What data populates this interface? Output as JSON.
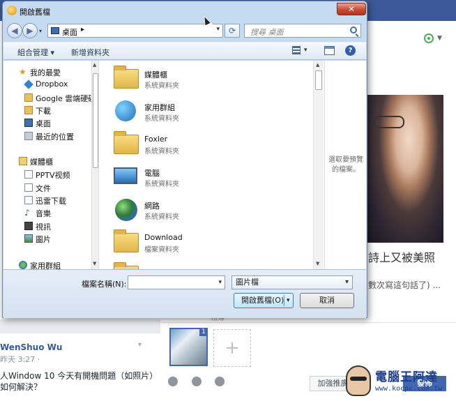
{
  "dialog": {
    "title": "開啟舊檔",
    "close_glyph": "✕",
    "address": {
      "location": "桌面",
      "chevron": "▸",
      "dropdown": "▾"
    },
    "search": {
      "placeholder": "搜尋 桌面"
    },
    "toolbar": {
      "organize": "組合管理 ▾",
      "new_folder": "新增資料夾",
      "help": "?"
    },
    "nav_pane": {
      "items": [
        {
          "label": "我的最愛",
          "icon": "star-icon"
        },
        {
          "label": "Dropbox",
          "icon": "dropbox-icon"
        },
        {
          "label": "Google 雲端硬碟",
          "icon": "drive-icon"
        },
        {
          "label": "下載",
          "icon": "downloads-icon"
        },
        {
          "label": "桌面",
          "icon": "desktop-icon"
        },
        {
          "label": "最近的位置",
          "icon": "recent-icon"
        },
        {
          "label": "媒體櫃",
          "icon": "library-icon"
        },
        {
          "label": "PPTV视频",
          "icon": "folder-icon"
        },
        {
          "label": "文件",
          "icon": "documents-icon"
        },
        {
          "label": "迅雷下载",
          "icon": "folder-icon"
        },
        {
          "label": "音樂",
          "icon": "music-icon"
        },
        {
          "label": "視訊",
          "icon": "video-icon"
        },
        {
          "label": "圖片",
          "icon": "pictures-icon"
        },
        {
          "label": "家用群組",
          "icon": "homegroup-icon"
        }
      ]
    },
    "files": [
      {
        "name": "媒體櫃",
        "type": "系統資料夾",
        "icon": "library-icon"
      },
      {
        "name": "家用群組",
        "type": "系統資料夾",
        "icon": "homegroup-icon"
      },
      {
        "name": "Foxler",
        "type": "系統資料夾",
        "icon": "user-folder-icon"
      },
      {
        "name": "電腦",
        "type": "系統資料夾",
        "icon": "computer-icon"
      },
      {
        "name": "網路",
        "type": "系統資料夾",
        "icon": "network-icon"
      },
      {
        "name": "Download",
        "type": "檔案資料夾",
        "icon": "folder-icon"
      }
    ],
    "preview_hint": "選取要預覽的檔案。",
    "filename_label": "檔案名稱(N):",
    "filename_value": "",
    "filetype": "圖片檔",
    "open_button": "開啟舊檔(O)",
    "cancel_button": "取消"
  },
  "background": {
    "headline": "詩上又被美照",
    "subline": "數次寫這句話了) ...",
    "tag": "相簿",
    "author": "WenShuo Wu",
    "time": "昨天 3:27 ·",
    "post_text": "人Window 10 今天有開機問題（如照片）如何解決？",
    "thumb_badge": "1",
    "add_photo": "+",
    "boost_button": "加強推廣貼",
    "post_button": "發佈",
    "watermark_title": "電腦王阿達",
    "watermark_url": "www.kocpc.com.tw"
  }
}
